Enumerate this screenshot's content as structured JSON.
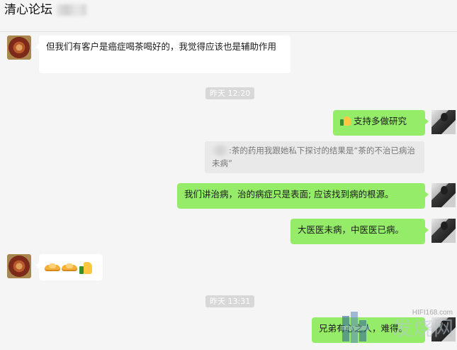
{
  "header": {
    "title": "清心论坛"
  },
  "messages": {
    "m1": "但我们有客户是癌症喝茶喝好的，我觉得应该也是辅助作用",
    "m2": "支持多做研究",
    "quote_text": ":茶的药用我跟她私下探讨的结果是“茶的不治已病治未病”",
    "m3": "我们讲治病，治的病症只是表面; 应该找到病的根源。",
    "m4": "大医医未病，中医医已病。",
    "m6": "兄弟有心之人，难得。"
  },
  "timestamps": {
    "t1": "昨天 12:20",
    "t2": "昨天 13:31"
  },
  "icons": {
    "thumb": "thumbs-up-icon",
    "handshake": "handshake-icon"
  },
  "watermark": {
    "url": "HIFI168.com",
    "text": "发烧网"
  },
  "colors": {
    "bubble_out": "#95ec69",
    "bubble_in": "#ffffff",
    "background": "#f5f5f5"
  }
}
